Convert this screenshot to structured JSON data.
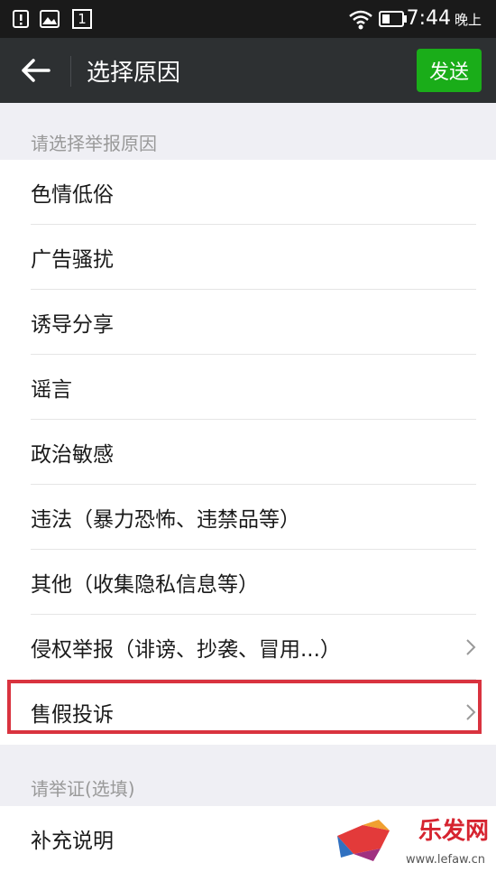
{
  "status_bar": {
    "time": "7:44",
    "period": "晚上",
    "sim_label": "1"
  },
  "nav": {
    "title": "选择原因",
    "send_label": "发送"
  },
  "section1": {
    "header": "请选择举报原因",
    "items": [
      {
        "label": "色情低俗"
      },
      {
        "label": "广告骚扰"
      },
      {
        "label": "诱导分享"
      },
      {
        "label": "谣言"
      },
      {
        "label": "政治敏感"
      },
      {
        "label": "违法（暴力恐怖、违禁品等）"
      },
      {
        "label": "其他（收集隐私信息等）"
      },
      {
        "label": "侵权举报（诽谤、抄袭、冒用...）"
      },
      {
        "label": "售假投诉"
      }
    ]
  },
  "section2": {
    "header": "请举证(选填)",
    "items": [
      {
        "label": "补充说明"
      }
    ]
  },
  "watermark": {
    "text": "乐发网",
    "url": "www.lefaw.cn"
  },
  "colors": {
    "send_green": "#1aad19",
    "highlight_red": "#d9333f",
    "nav_bg": "#2d3032"
  }
}
